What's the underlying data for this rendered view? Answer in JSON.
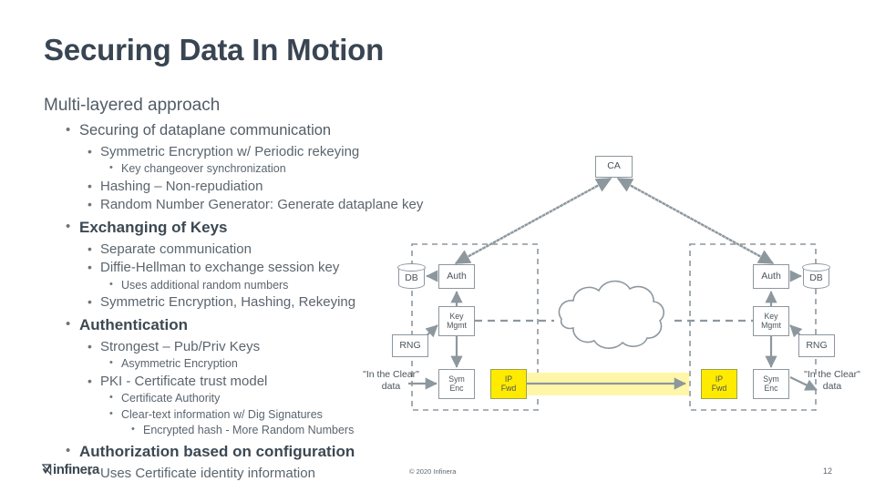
{
  "slide": {
    "title": "Securing Data In Motion",
    "heading": "Multi-layered approach"
  },
  "bullets": [
    {
      "level": 1,
      "text": "Securing of dataplane communication",
      "bold": false
    },
    {
      "level": 2,
      "text": "Symmetric Encryption w/ Periodic rekeying",
      "bold": false
    },
    {
      "level": 3,
      "text": "Key changeover synchronization",
      "bold": false
    },
    {
      "level": 2,
      "text": "Hashing – Non-repudiation",
      "bold": false
    },
    {
      "level": 2,
      "text": "Random Number Generator: Generate dataplane key",
      "bold": false
    },
    {
      "level": 1,
      "text": "Exchanging of Keys",
      "bold": true
    },
    {
      "level": 2,
      "text": "Separate communication",
      "bold": false
    },
    {
      "level": 2,
      "text": "Diffie-Hellman to exchange session key",
      "bold": false
    },
    {
      "level": 3,
      "text": "Uses additional random numbers",
      "bold": false
    },
    {
      "level": 2,
      "text": "Symmetric Encryption, Hashing, Rekeying",
      "bold": false
    },
    {
      "level": 1,
      "text": "Authentication",
      "bold": true
    },
    {
      "level": 2,
      "text": "Strongest – Pub/Priv Keys",
      "bold": false
    },
    {
      "level": 3,
      "text": "Asymmetric Encryption",
      "bold": false
    },
    {
      "level": 2,
      "text": "PKI - Certificate trust model",
      "bold": false
    },
    {
      "level": 3,
      "text": "Certificate Authority",
      "bold": false
    },
    {
      "level": 3,
      "text": "Clear-text information w/ Dig Signatures",
      "bold": false
    },
    {
      "level": 4,
      "text": "Encrypted hash - More Random Numbers",
      "bold": false
    },
    {
      "level": 1,
      "text": "Authorization based on configuration",
      "bold": true
    },
    {
      "level": 2,
      "text": "Uses Certificate identity information",
      "bold": false
    }
  ],
  "diagram": {
    "ca": {
      "label": "CA"
    },
    "left": {
      "db": "DB",
      "auth": "Auth",
      "key_mgmt_line1": "Key",
      "key_mgmt_line2": "Mgmt",
      "rng": "RNG",
      "sym_enc_line1": "Sym",
      "sym_enc_line2": "Enc",
      "ip_fwd_line1": "IP",
      "ip_fwd_line2": "Fwd",
      "clear_label_line1": "\"In the Clear\"",
      "clear_label_line2": "data"
    },
    "right": {
      "db": "DB",
      "auth": "Auth",
      "key_mgmt_line1": "Key",
      "key_mgmt_line2": "Mgmt",
      "rng": "RNG",
      "sym_enc_line1": "Sym",
      "sym_enc_line2": "Enc",
      "ip_fwd_line1": "IP",
      "ip_fwd_line2": "Fwd",
      "clear_label_line1": "\"In the Clear\"",
      "clear_label_line2": "data"
    },
    "colors": {
      "stroke": "#8d979e",
      "yellow": "#ffeb00",
      "pipe_glow": "#fff6a8"
    }
  },
  "footer": {
    "logo_text": "infinera",
    "copyright": "© 2020 Infinera",
    "page_number": "12"
  }
}
